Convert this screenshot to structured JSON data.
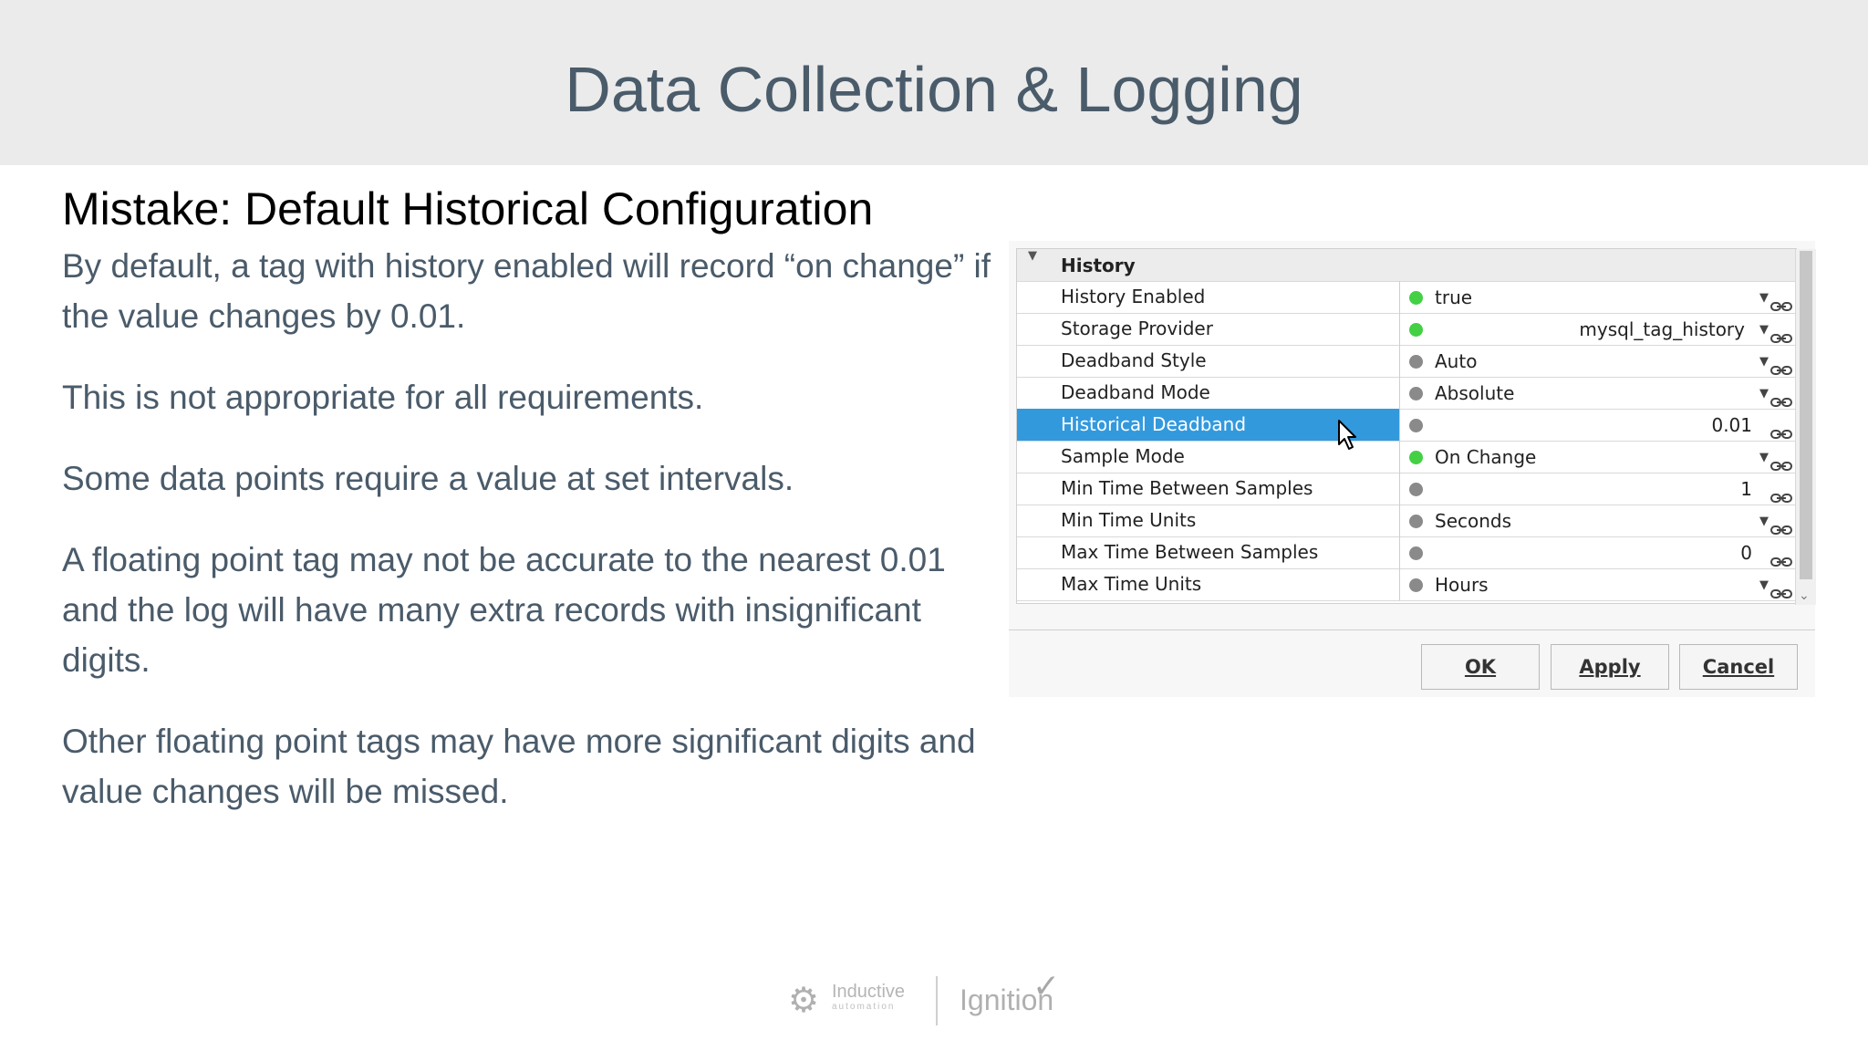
{
  "slide": {
    "title": "Data Collection & Logging",
    "heading": "Mistake: Default Historical Configuration",
    "paragraphs": [
      "By default, a tag with history enabled will record “on change” if the value changes by 0.01.",
      "This is not appropriate for all requirements.",
      "Some data points require a value at set intervals.",
      "A floating point tag may not be accurate to the nearest 0.01 and the log will have many extra records with insignificant digits.",
      "Other floating point tags may have more significant digits and value changes will be missed."
    ]
  },
  "editor": {
    "group_label": "History",
    "rows": [
      {
        "name": "History Enabled",
        "value": "true",
        "status": "green",
        "align": "left",
        "dropdown": true
      },
      {
        "name": "Storage Provider",
        "value": "mysql_tag_history",
        "status": "green",
        "align": "right",
        "dropdown": true
      },
      {
        "name": "Deadband Style",
        "value": "Auto",
        "status": "gray",
        "align": "left",
        "dropdown": true
      },
      {
        "name": "Deadband Mode",
        "value": "Absolute",
        "status": "gray",
        "align": "left",
        "dropdown": true
      },
      {
        "name": "Historical Deadband",
        "value": "0.01",
        "status": "gray",
        "align": "right",
        "dropdown": false,
        "selected": true
      },
      {
        "name": "Sample Mode",
        "value": "On Change",
        "status": "green",
        "align": "left",
        "dropdown": true
      },
      {
        "name": "Min Time Between Samples",
        "value": "1",
        "status": "gray",
        "align": "right",
        "dropdown": false
      },
      {
        "name": "Min Time Units",
        "value": "Seconds",
        "status": "gray",
        "align": "left",
        "dropdown": true
      },
      {
        "name": "Max Time Between Samples",
        "value": "0",
        "status": "gray",
        "align": "right",
        "dropdown": false
      },
      {
        "name": "Max Time Units",
        "value": "Hours",
        "status": "gray",
        "align": "left",
        "dropdown": true
      }
    ],
    "buttons": {
      "ok": "OK",
      "apply": "Apply",
      "cancel": "Cancel"
    }
  },
  "footer": {
    "brand1": "Inductive",
    "brand1_sub": "automation",
    "brand2": "Ignition"
  },
  "colors": {
    "title": "#4a5b6a",
    "selection": "#3399dd",
    "status_green": "#44d044",
    "status_gray": "#8a8a8a"
  }
}
